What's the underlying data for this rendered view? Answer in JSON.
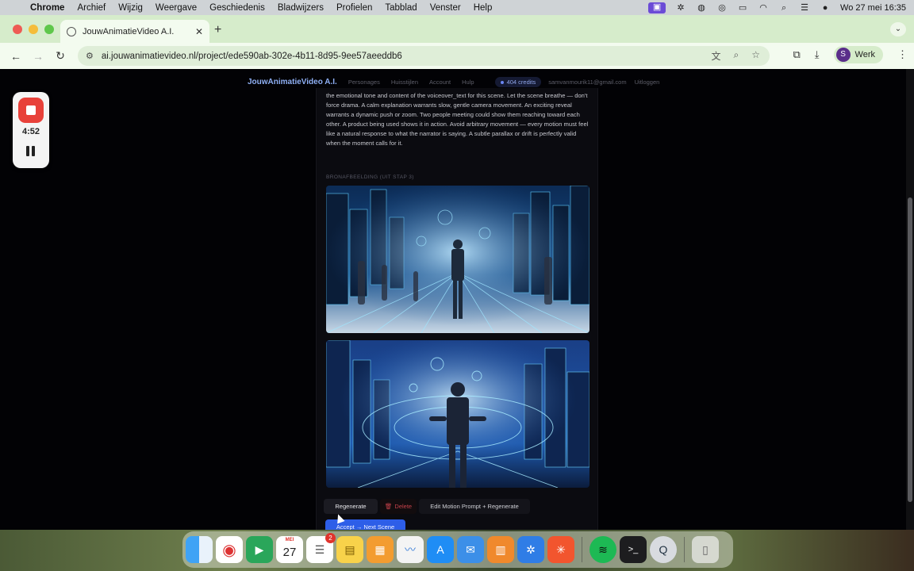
{
  "menubar": {
    "app_name": "Chrome",
    "items": [
      "Archief",
      "Wijzig",
      "Weergave",
      "Geschiedenis",
      "Bladwijzers",
      "Profielen",
      "Tabblad",
      "Venster",
      "Help"
    ],
    "clock": "Wo 27 mei  16:35"
  },
  "browser": {
    "tab_title": "JouwAnimatieVideo A.I.",
    "url": "ai.jouwanimatievideo.nl/project/ede590ab-302e-4b11-8d95-9ee57aeeddb6",
    "profile_initial": "S",
    "profile_name": "Werk"
  },
  "site": {
    "brand": "JouwAnimatieVideo A.I.",
    "nav": [
      "Personages",
      "Huisstijlen",
      "Account",
      "Hulp"
    ],
    "credits": "404 credits",
    "email": "samvanmourik11@gmail.com",
    "logout": "Uitloggen"
  },
  "scene": {
    "prompt_text": "the emotional tone and content of the voiceover_text for this scene. Let the scene breathe — don't force drama. A calm explanation warrants slow, gentle camera movement. An exciting reveal warrants a dynamic push or zoom. Two people meeting could show them reaching toward each other. A product being used shows it in action. Avoid arbitrary movement — every motion must feel like a natural response to what the narrator is saying. A subtle parallax or drift is perfectly valid when the moment calls for it.",
    "source_label": "BRONAFBEELDING (UIT STAP 3)",
    "buttons": {
      "regenerate": "Regenerate",
      "delete": "Delete",
      "edit_motion": "Edit Motion Prompt + Regenerate",
      "accept": "Accept → Next Scene"
    }
  },
  "recorder": {
    "elapsed": "4:52"
  },
  "dock": {
    "calendar_month": "MEI",
    "calendar_day": "27",
    "reminders_badge": "2"
  },
  "colors": {
    "accent": "#2d5ee8",
    "brand": "#8fb0f5",
    "danger": "#c4414a",
    "page_bg": "#020205",
    "tabstrip_bg": "#d6eccb"
  }
}
